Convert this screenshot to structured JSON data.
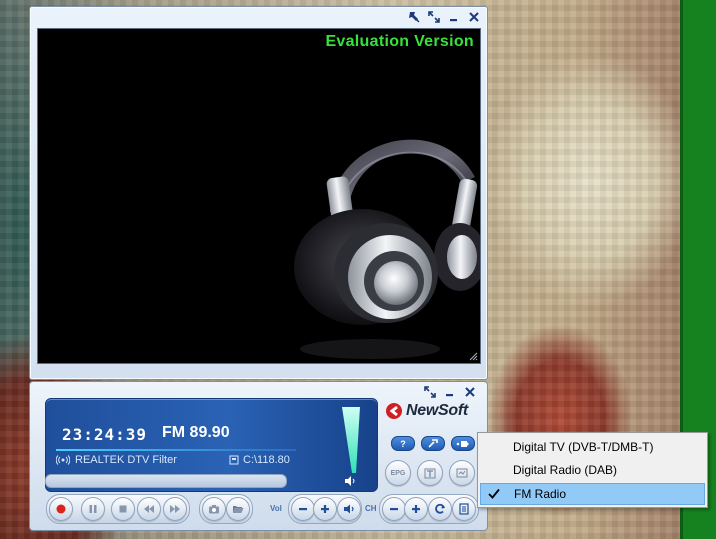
{
  "video_window": {
    "overlay_text": "Evaluation Version",
    "controls": [
      "pin-icon",
      "restore-icon",
      "minimize-icon",
      "close-icon"
    ]
  },
  "control_panel": {
    "controls": [
      "restore-icon",
      "minimize-icon",
      "close-icon"
    ],
    "time": "23:24:39",
    "frequency": "FM 89.90",
    "source": "REALTEK DTV Filter",
    "storage": "C:\\118.80",
    "brand": "NewSoft",
    "vol_label": "Vol",
    "ch_label": "CH",
    "buttons": {
      "epg": "EPG",
      "teletext": "T",
      "info": "info-icon"
    }
  },
  "context_menu": {
    "items": [
      {
        "label": "Digital TV (DVB-T/DMB-T)",
        "checked": false
      },
      {
        "label": "Digital Radio (DAB)",
        "checked": false
      },
      {
        "label": "FM Radio",
        "checked": true
      }
    ]
  },
  "colors": {
    "display_blue": "#2a62b5",
    "eval_green": "#36e23a",
    "menu_highlight": "#91c9f7",
    "desktop_green": "#16821f"
  }
}
